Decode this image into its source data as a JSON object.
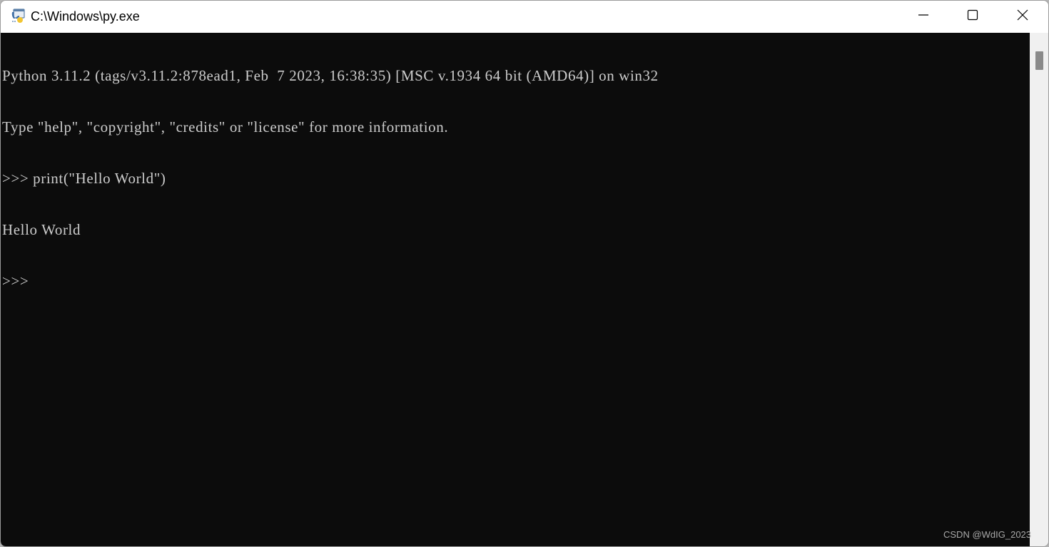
{
  "window": {
    "title": "C:\\Windows\\py.exe",
    "icon": "python-launcher-icon",
    "controls": {
      "minimize": "minimize-icon",
      "maximize": "maximize-icon",
      "close": "close-icon"
    }
  },
  "console": {
    "lines": [
      "Python 3.11.2 (tags/v3.11.2:878ead1, Feb  7 2023, 16:38:35) [MSC v.1934 64 bit (AMD64)] on win32",
      "Type \"help\", \"copyright\", \"credits\" or \"license\" for more information.",
      ">>> print(\"Hello World\")",
      "Hello World",
      ">>> "
    ],
    "colors": {
      "background": "#0c0c0c",
      "foreground": "#cccccc"
    }
  },
  "scrollbar": {
    "position_fraction": 0.0
  },
  "watermark": "CSDN @WdIG_2023"
}
